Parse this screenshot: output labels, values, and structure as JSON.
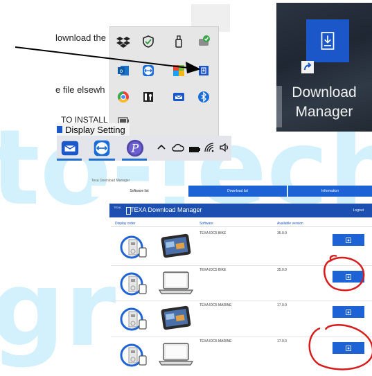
{
  "document": {
    "line1": "lownload the",
    "line2": "e file elsewh",
    "line3": "TO INSTALL"
  },
  "display_settings": {
    "label": "Display Setting",
    "icon": "display-settings-icon"
  },
  "tray": {
    "icons": [
      "dropbox-icon",
      "shield-icon",
      "usb-drive-icon",
      "security-check-icon",
      "outlook-icon",
      "teamviewer-icon",
      "microsoft-office-icon",
      "download-manager-icon",
      "chrome-icon",
      "key-app-icon",
      "texa-app-icon",
      "bluetooth-icon",
      "battery-icon"
    ]
  },
  "taskbar": {
    "apps": [
      "texa-app-icon",
      "teamviewer-icon",
      "p-app-icon"
    ],
    "tray": [
      "chevron-up-icon",
      "cloud-icon",
      "battery-icon",
      "wifi-icon",
      "speaker-icon"
    ]
  },
  "desktop": {
    "label_line1": "Download",
    "label_line2": "Manager"
  },
  "watermark": {
    "line1": "to-Tech",
    "line2": "gr"
  },
  "app": {
    "top_text": "Texa Download Manager",
    "tabs": [
      "Software list",
      "Download list",
      "Information"
    ],
    "logo": "TEXA",
    "title": "TEXA Download Manager",
    "logout": "Logout",
    "columns": [
      "Display order",
      "Software",
      "Available version"
    ],
    "rows": [
      {
        "name": "TEXA IDC5 BIKE",
        "version": "35.0.0",
        "device": "tablet"
      },
      {
        "name": "TEXA IDC5 BIKE",
        "version": "35.0.0",
        "device": "laptop"
      },
      {
        "name": "TEXA IDC5 MARINE",
        "version": "17.0.0",
        "device": "tablet"
      },
      {
        "name": "TEXA IDC5 MARINE",
        "version": "17.0.0",
        "device": "laptop"
      }
    ]
  },
  "colors": {
    "brand": "#1c4fb0",
    "button": "#1e63d5",
    "watermark": "#29b6f6",
    "annotation": "#d81c1c"
  }
}
